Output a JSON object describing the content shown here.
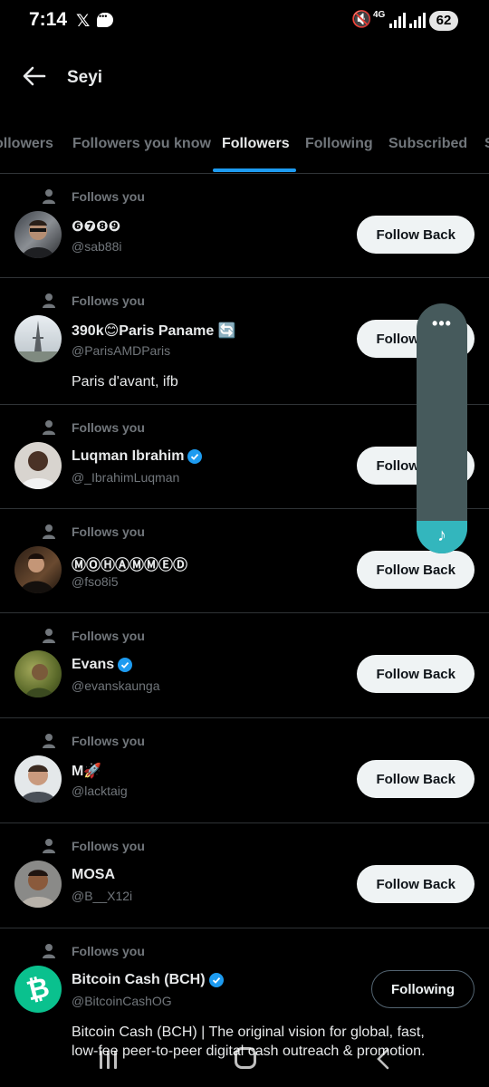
{
  "status_bar": {
    "time": "7:14",
    "x_glyph": "𝕏",
    "network": "4G",
    "battery": "62"
  },
  "header": {
    "title": "Seyi"
  },
  "tabs": [
    {
      "label": "ollowers",
      "active": false
    },
    {
      "label": "Followers you know",
      "active": false
    },
    {
      "label": "Followers",
      "active": true
    },
    {
      "label": "Following",
      "active": false
    },
    {
      "label": "Subscribed",
      "active": false
    },
    {
      "label": "S",
      "active": false
    }
  ],
  "followers": [
    {
      "follows_you": "Follows you",
      "name": "🅞🅞🅞🅞",
      "name_text": "❻❼❽❾",
      "handle": "@sab88i",
      "verified": false,
      "button": "Follow Back",
      "bio": ""
    },
    {
      "follows_you": "Follows you",
      "name_text": "390k😊Paris Paname 🔄",
      "handle": "@ParisAMDParis",
      "verified": false,
      "button": "Follow Back",
      "bio": "Paris d'avant, ifb"
    },
    {
      "follows_you": "Follows you",
      "name_text": "Luqman Ibrahim",
      "handle": "@_IbrahimLuqman",
      "verified": true,
      "button": "Follow Back",
      "bio": ""
    },
    {
      "follows_you": "Follows you",
      "name_text": "ⓂⓄⒽⒶⓂⓂⒺⒹ",
      "handle": "@fso8i5",
      "verified": false,
      "button": "Follow Back",
      "bio": ""
    },
    {
      "follows_you": "Follows you",
      "name_text": "Evans",
      "handle": "@evanskaunga",
      "verified": true,
      "button": "Follow Back",
      "bio": ""
    },
    {
      "follows_you": "Follows you",
      "name_text": "M🚀",
      "handle": "@lacktaig",
      "verified": false,
      "button": "Follow Back",
      "bio": ""
    },
    {
      "follows_you": "Follows you",
      "name_text": "MOSA",
      "handle": "@B__X12i",
      "verified": false,
      "button": "Follow Back",
      "bio": ""
    },
    {
      "follows_you": "Follows you",
      "name_text": "Bitcoin Cash (BCH)",
      "handle": "@BitcoinCashOG",
      "verified": true,
      "button": "Following",
      "bio": "Bitcoin Cash (BCH) | The original vision for global, fast, low-fee peer-to-peer digital cash outreach & promotion."
    }
  ],
  "colors": {
    "background": "#000000",
    "accent": "#1d9bf0",
    "muted": "#71767b",
    "widget": "#465a5c",
    "widget_accent": "#33b6bd",
    "bitcoin_green": "#0ac18e"
  },
  "icons": [
    "back-arrow-icon",
    "person-icon",
    "verified-badge-icon",
    "more-dots-icon",
    "music-note-icon"
  ]
}
